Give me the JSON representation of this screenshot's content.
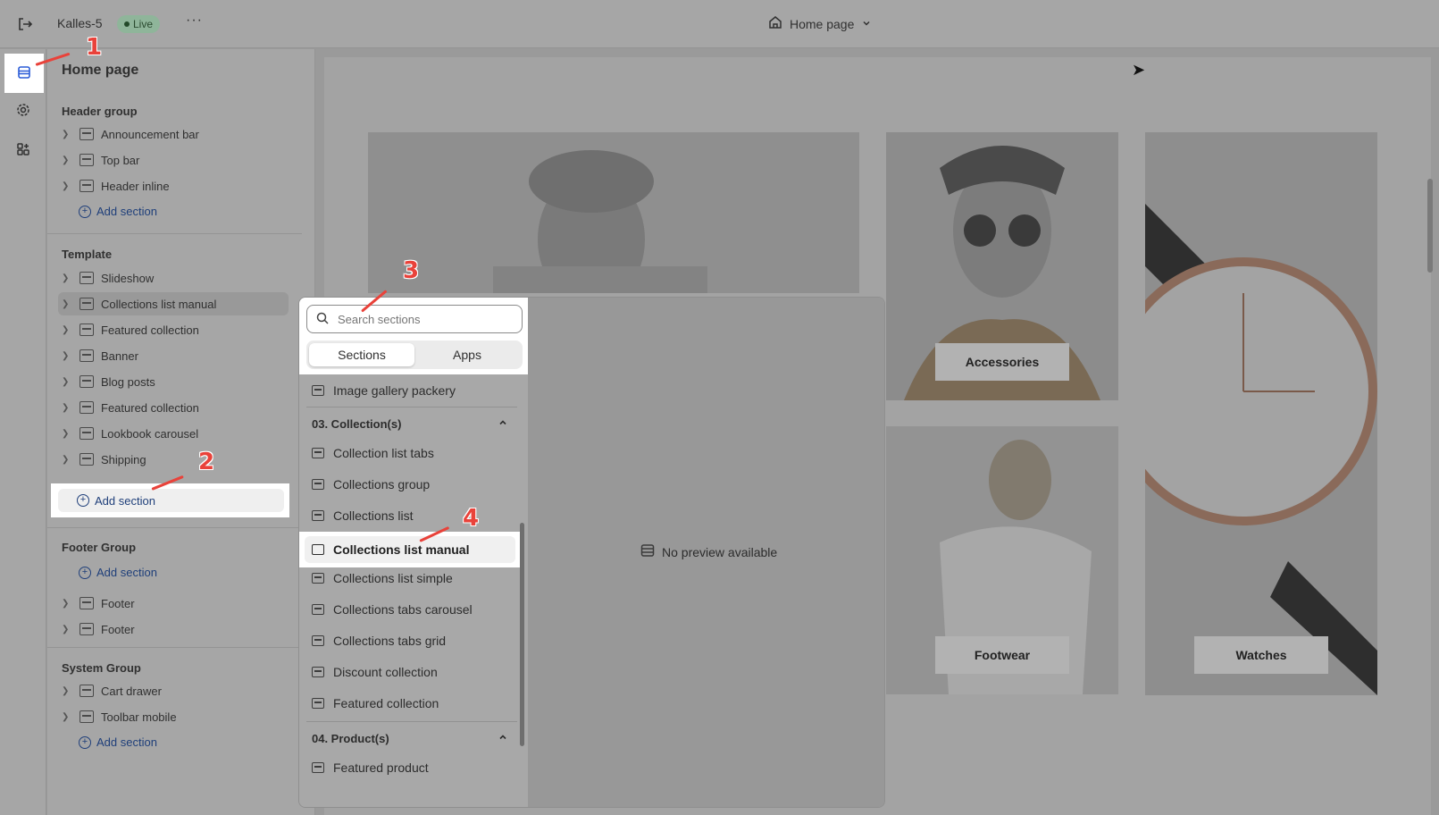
{
  "topbar": {
    "store_name": "Kalles-5",
    "status": "Live",
    "more": "···",
    "page_selector": "Home page"
  },
  "sidebar": {
    "title": "Home page",
    "header_group": {
      "title": "Header group",
      "items": [
        "Announcement bar",
        "Top bar",
        "Header inline"
      ],
      "add": "Add section"
    },
    "template": {
      "title": "Template",
      "items": [
        "Slideshow",
        "Collections list manual",
        "Featured collection",
        "Banner",
        "Blog posts",
        "Featured collection",
        "Lookbook carousel",
        "Shipping"
      ],
      "add": "Add section"
    },
    "footer_group": {
      "title": "Footer Group",
      "add": "Add section",
      "items": [
        "Footer",
        "Footer"
      ]
    },
    "system_group": {
      "title": "System Group",
      "items": [
        "Cart drawer",
        "Toolbar mobile"
      ],
      "add": "Add section"
    }
  },
  "picker": {
    "search_placeholder": "Search sections",
    "tabs": [
      "Sections",
      "Apps"
    ],
    "top_item": "Image gallery packery",
    "category_collections": "03. Collection(s)",
    "collection_items": [
      "Collection list tabs",
      "Collections group",
      "Collections list",
      "Collections list manual",
      "Collections list simple",
      "Collections tabs carousel",
      "Collections tabs grid",
      "Discount collection",
      "Featured collection"
    ],
    "category_products": "04. Product(s)",
    "product_items": [
      "Featured product"
    ],
    "no_preview": "No preview available"
  },
  "preview": {
    "captions": [
      "Accessories",
      "Footwear",
      "Watches"
    ]
  },
  "annotations": [
    "1",
    "2",
    "3",
    "4"
  ],
  "colors": {
    "accent_annotation": "#e9423a",
    "link": "#1f3f7a",
    "live_badge": "#8fb59a"
  }
}
